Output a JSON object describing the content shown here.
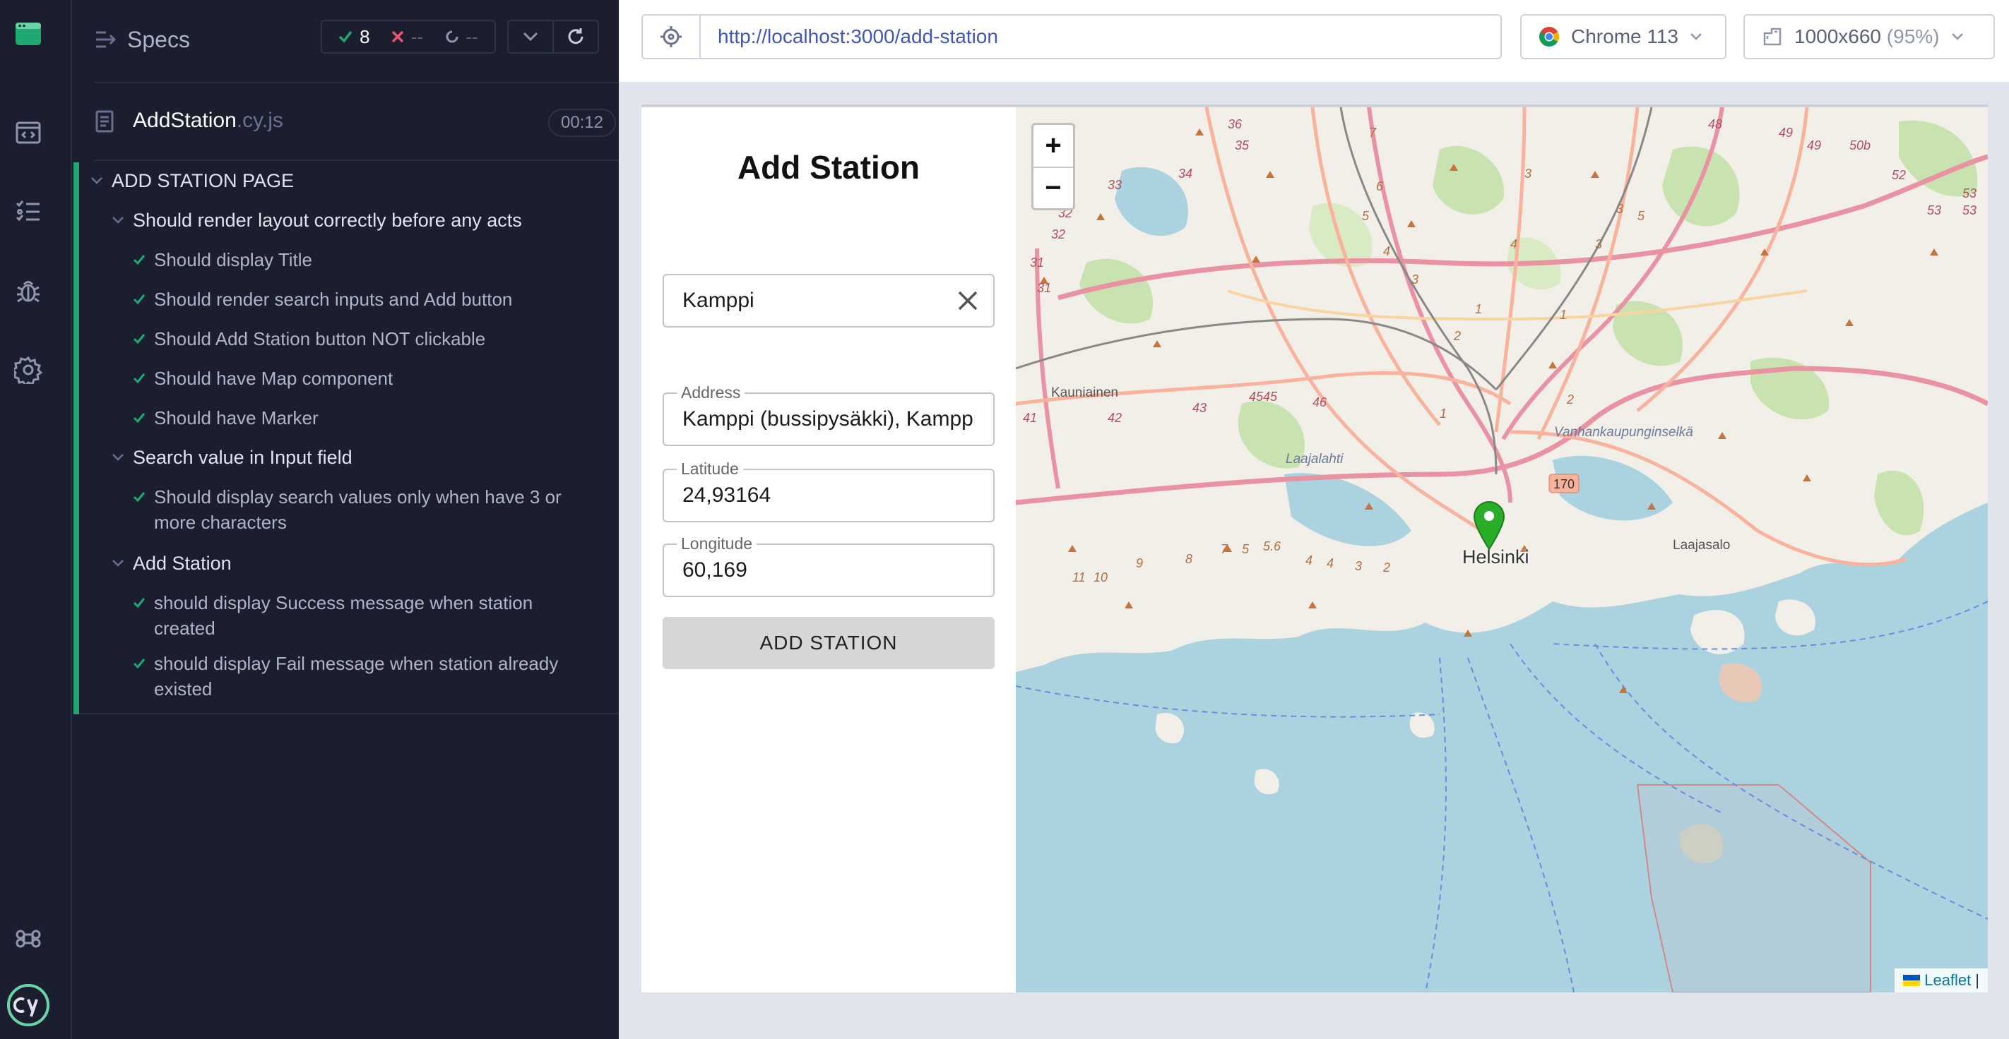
{
  "rail": {
    "icons": [
      "cypress-app-icon",
      "specs-icon",
      "runs-icon",
      "debug-icon",
      "settings-icon",
      "keyboard-shortcuts-icon",
      "cypress-logo-icon"
    ]
  },
  "reporter": {
    "specs_label": "Specs",
    "stats": {
      "passed": "8",
      "failed": "--",
      "pending": "--"
    },
    "spec_file": {
      "name": "AddStation",
      "ext": ".cy.js",
      "duration": "00:12"
    },
    "suites": [
      {
        "title": "ADD STATION PAGE",
        "children": [
          {
            "title": "Should render layout correctly before any acts",
            "tests": [
              "Should display Title",
              "Should render search inputs and Add button",
              "Should Add Station button NOT clickable",
              "Should have Map component",
              "Should have Marker"
            ]
          },
          {
            "title": "Search value in Input field",
            "tests": [
              "Should display search values only when have 3 or more characters"
            ]
          },
          {
            "title": "Add Station",
            "tests": [
              "should display Success message when station created",
              "should display Fail message when station already existed"
            ]
          }
        ]
      }
    ]
  },
  "topbar": {
    "url": "http://localhost:3000/add-station",
    "browser": "Chrome 113",
    "viewport": "1000x660",
    "viewport_scale": "(95%)"
  },
  "app": {
    "title": "Add Station",
    "search_value": "Kamppi",
    "address": {
      "label": "Address",
      "value": "Kamppi (bussipysäkki), Kamppi"
    },
    "latitude": {
      "label": "Latitude",
      "value": "24,93164"
    },
    "longitude": {
      "label": "Longitude",
      "value": "60,169"
    },
    "add_button": "ADD STATION"
  },
  "map": {
    "zoom_in": "+",
    "zoom_out": "−",
    "city_label": "Helsinki",
    "labels": [
      "Kauniainen",
      "Laajasalo",
      "Laajalahti",
      "Vanhankaupunginselkä"
    ],
    "road_numbers": [
      "170",
      "36",
      "35",
      "34",
      "33",
      "32",
      "31",
      "41",
      "42",
      "43",
      "45",
      "46",
      "48",
      "49",
      "50b",
      "52",
      "53",
      "5",
      "6",
      "7",
      "4",
      "3",
      "2",
      "1"
    ],
    "attribution": "Leaflet",
    "colors": {
      "water": "#aad3df",
      "land": "#f2efe9",
      "forest": "#c8e3b0",
      "motorway": "#e892a2",
      "trunk": "#f9b29c",
      "marker": "#2aad27"
    }
  }
}
